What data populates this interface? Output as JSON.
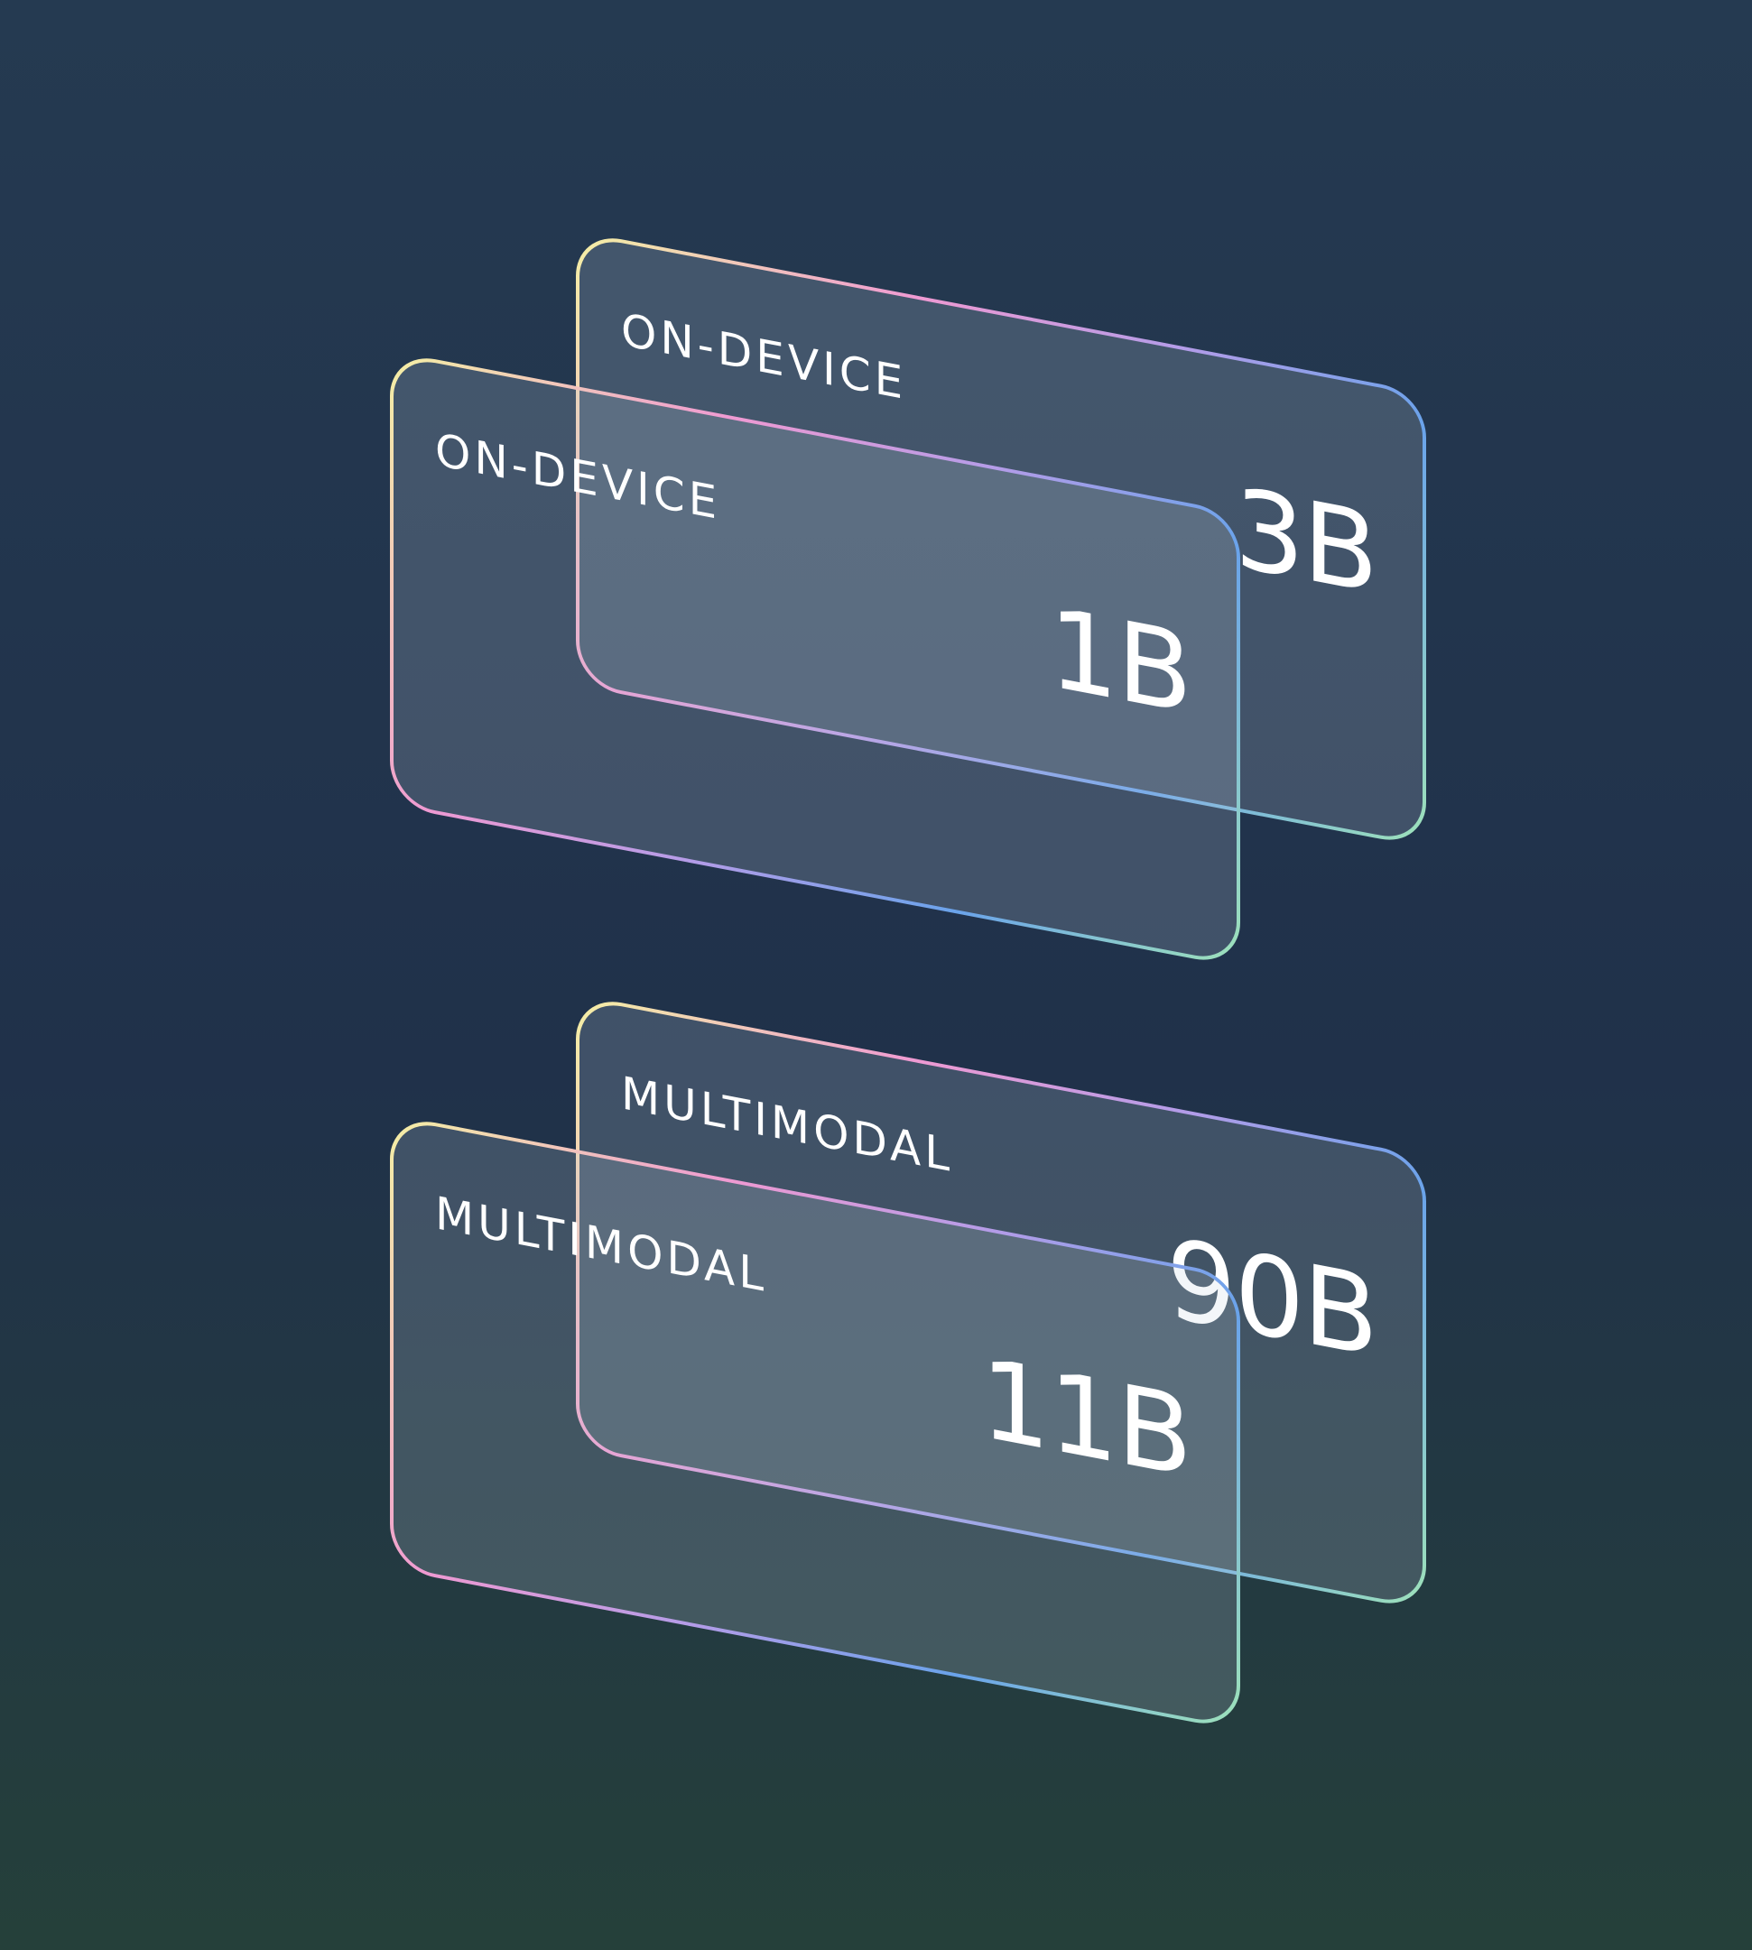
{
  "colors": {
    "background_top": "#253a51",
    "background_mid": "#20314a",
    "background_bottom": "#25403a",
    "card_fill": "#c4d2e3",
    "border_yellow": "#f4f0a4",
    "border_pink": "#ef9ad2",
    "border_purple": "#b49ce8",
    "border_blue": "#6aa3ea",
    "border_green": "#a9efb0"
  },
  "groups": [
    {
      "name": "on-device",
      "cards": [
        {
          "label": "ON-DEVICE",
          "value": "3B"
        },
        {
          "label": "ON-DEVICE",
          "value": "1B"
        }
      ]
    },
    {
      "name": "multimodal",
      "cards": [
        {
          "label": "MULTIMODAL",
          "value": "90B"
        },
        {
          "label": "MULTIMODAL",
          "value": "11B"
        }
      ]
    }
  ]
}
